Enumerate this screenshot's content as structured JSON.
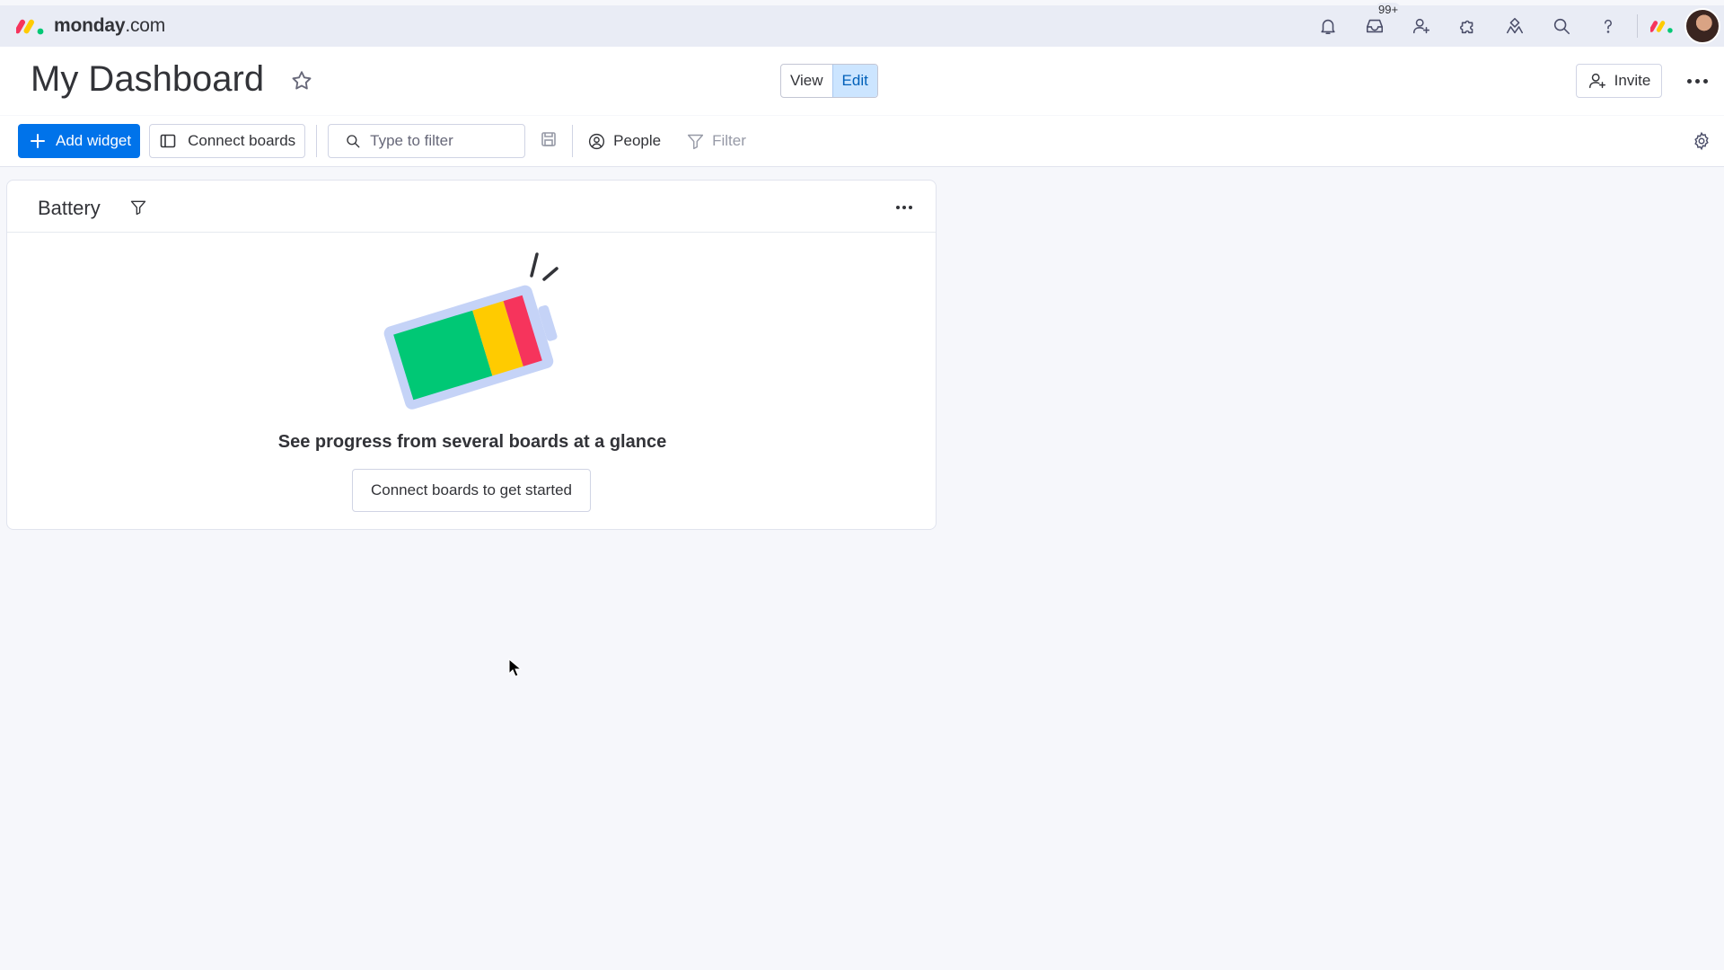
{
  "topbar": {
    "brand_bold": "monday",
    "brand_light": ".com",
    "inbox_badge": "99+"
  },
  "header": {
    "title": "My Dashboard",
    "view_label": "View",
    "edit_label": "Edit",
    "invite_label": "Invite"
  },
  "toolbar": {
    "add_widget_label": "Add widget",
    "connect_boards_label": "Connect boards",
    "search_placeholder": "Type to filter",
    "people_label": "People",
    "filter_label": "Filter"
  },
  "widget": {
    "title": "Battery",
    "empty_message": "See progress from several boards at a glance",
    "cta_label": "Connect boards to get started"
  },
  "colors": {
    "primary": "#0073ea",
    "battery_green": "#00c875",
    "battery_yellow": "#ffcb00",
    "battery_red": "#f6345c",
    "battery_frame": "#c5d3f7"
  }
}
